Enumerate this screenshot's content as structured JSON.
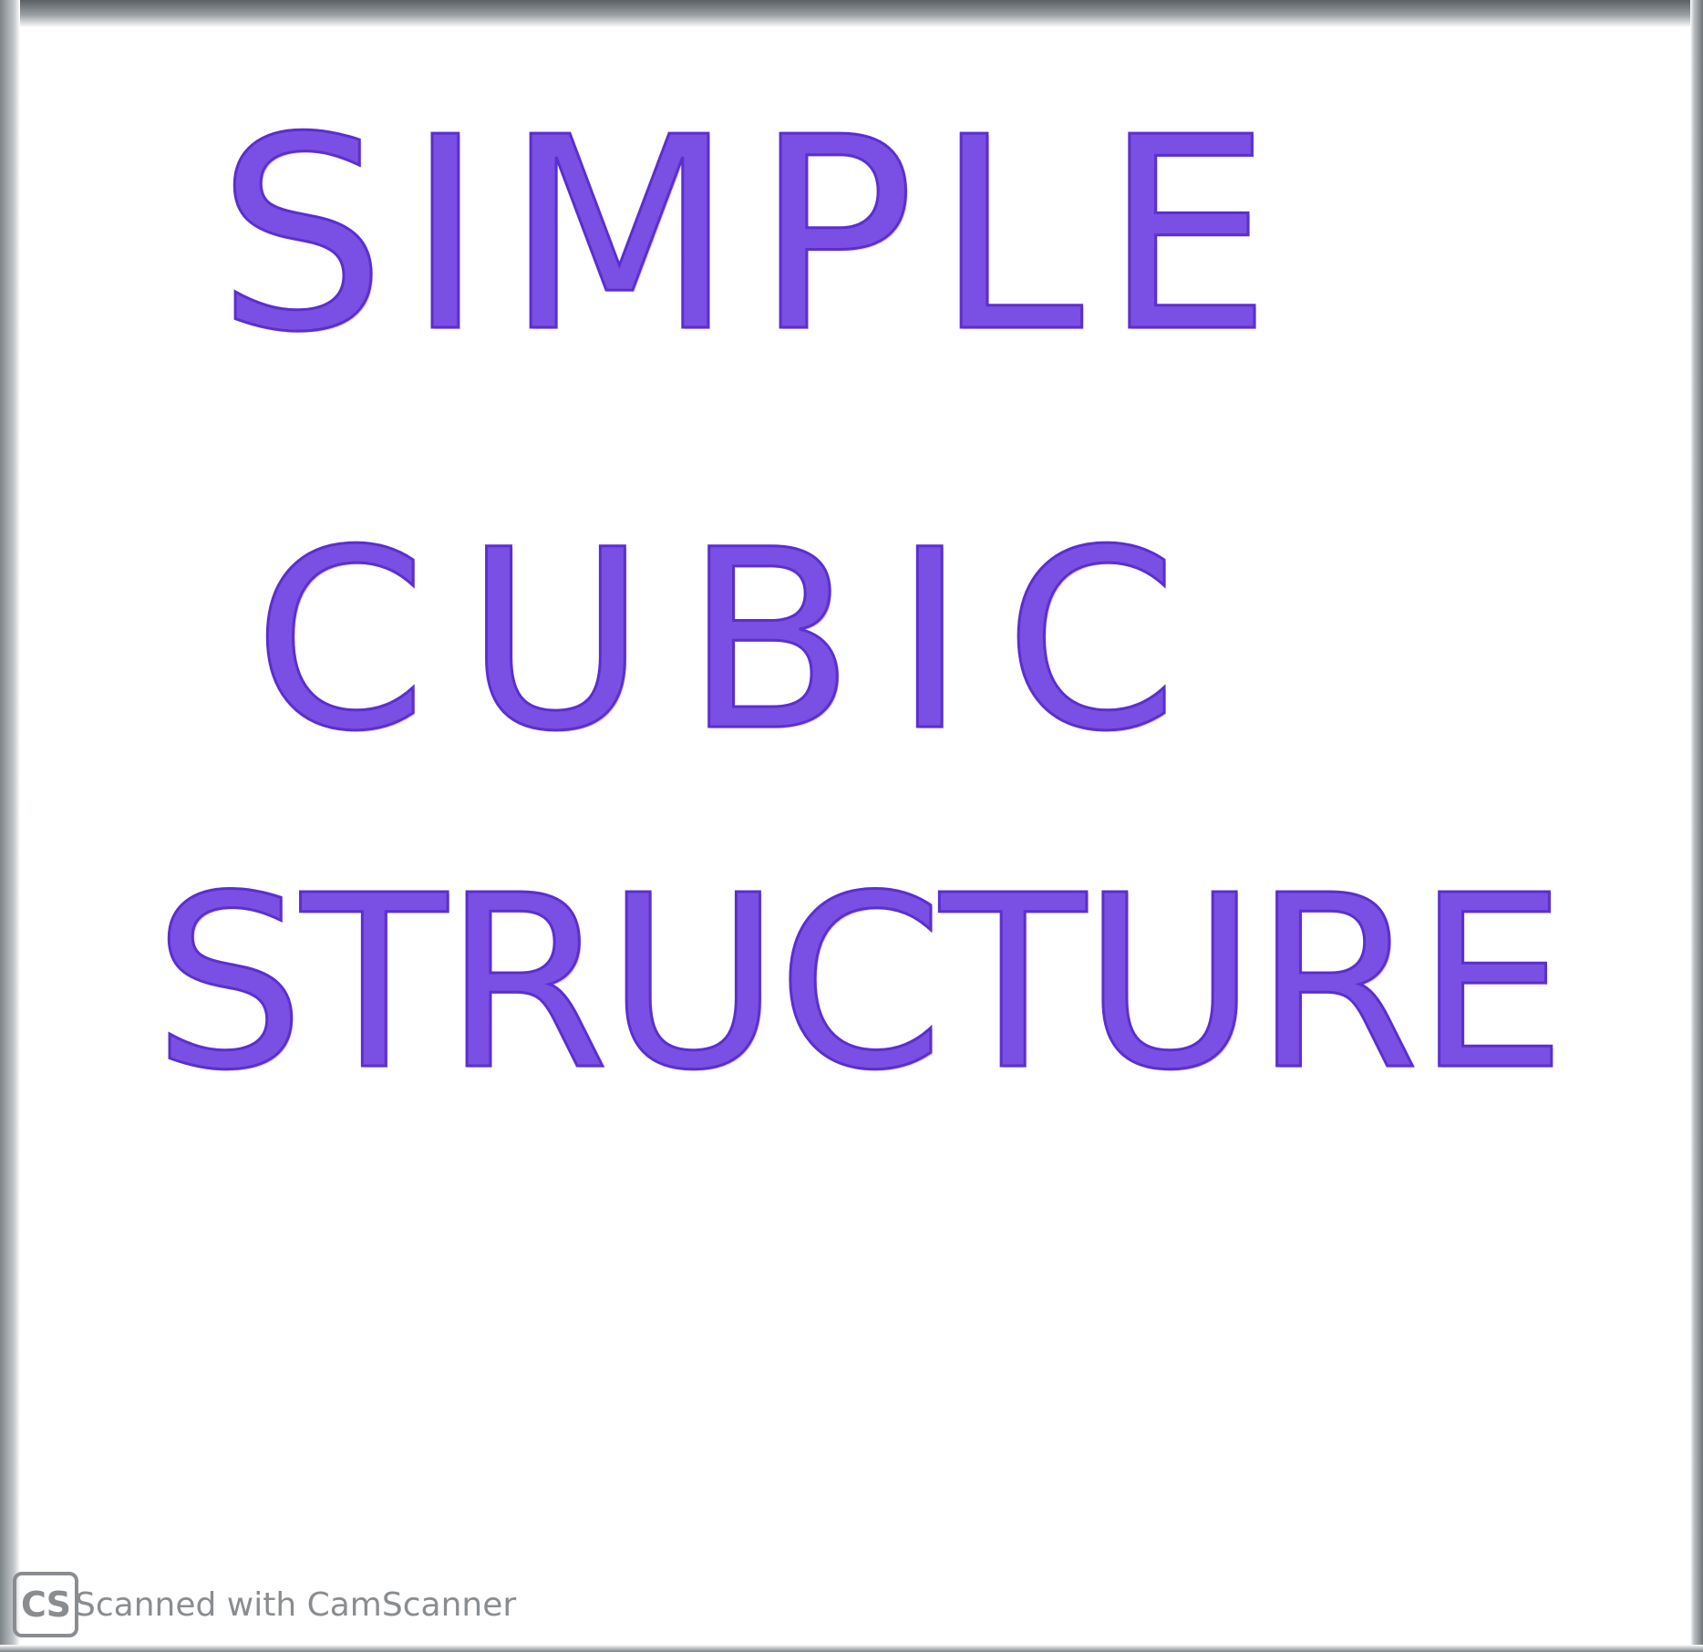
{
  "document": {
    "lines": [
      "SIMPLE",
      "CUBIC",
      "STRUCTURE"
    ]
  },
  "watermark": {
    "logo": "CS",
    "text": "Scanned with CamScanner"
  },
  "colors": {
    "ink": "#7a4fe3",
    "ink_outline": "#5b2fcf",
    "paper": "#ffffff",
    "watermark": "#8a8d90"
  }
}
